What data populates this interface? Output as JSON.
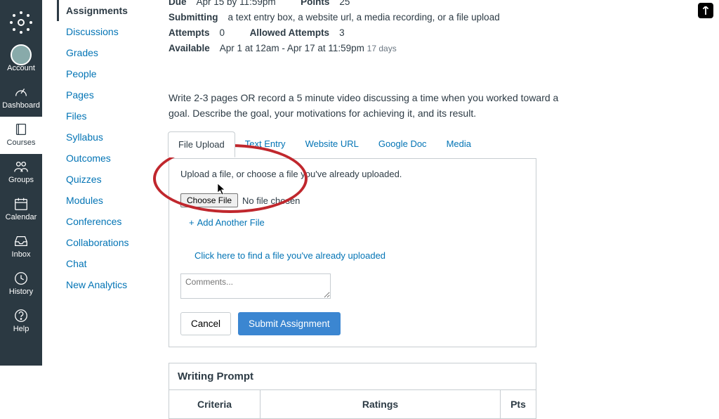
{
  "global_nav": {
    "items": [
      {
        "label": "Account",
        "icon": "avatar"
      },
      {
        "label": "Dashboard",
        "icon": "speedometer"
      },
      {
        "label": "Courses",
        "icon": "book"
      },
      {
        "label": "Groups",
        "icon": "people"
      },
      {
        "label": "Calendar",
        "icon": "calendar"
      },
      {
        "label": "Inbox",
        "icon": "inbox"
      },
      {
        "label": "History",
        "icon": "clock"
      },
      {
        "label": "Help",
        "icon": "question"
      }
    ],
    "active_index": 2
  },
  "course_nav": {
    "items": [
      "Assignments",
      "Discussions",
      "Grades",
      "People",
      "Pages",
      "Files",
      "Syllabus",
      "Outcomes",
      "Quizzes",
      "Modules",
      "Conferences",
      "Collaborations",
      "Chat",
      "New Analytics"
    ],
    "active_index": 0
  },
  "assignment": {
    "meta": {
      "due_label": "Due",
      "due_value": "Apr 15 by 11:59pm",
      "points_label": "Points",
      "points_value": "25",
      "submitting_label": "Submitting",
      "submitting_value": "a text entry box, a website url, a media recording, or a file upload",
      "attempts_label": "Attempts",
      "attempts_value": "0",
      "allowed_attempts_label": "Allowed Attempts",
      "allowed_attempts_value": "3",
      "available_label": "Available",
      "available_value": "Apr 1 at 12am - Apr 17 at 11:59pm",
      "available_days": "17 days"
    },
    "description": "Write 2-3 pages OR record a 5 minute video discussing a time when you worked toward a goal. Describe the goal, your motivations for achieving it, and its result."
  },
  "submission": {
    "tabs": [
      "File Upload",
      "Text Entry",
      "Website URL",
      "Google Doc",
      "Media"
    ],
    "active_tab": 0,
    "upload_hint": "Upload a file, or choose a file you've already uploaded.",
    "choose_button": "Choose File",
    "no_file_text": "No file chosen",
    "add_another": "Add Another File",
    "find_link": "Click here to find a file you've already uploaded",
    "comments_placeholder": "Comments...",
    "cancel": "Cancel",
    "submit": "Submit Assignment"
  },
  "rubric": {
    "title": "Writing Prompt",
    "cols": [
      "Criteria",
      "Ratings",
      "Pts"
    ]
  },
  "annotation": {
    "ellipse_target": "choose-file",
    "color": "#c0272d"
  }
}
